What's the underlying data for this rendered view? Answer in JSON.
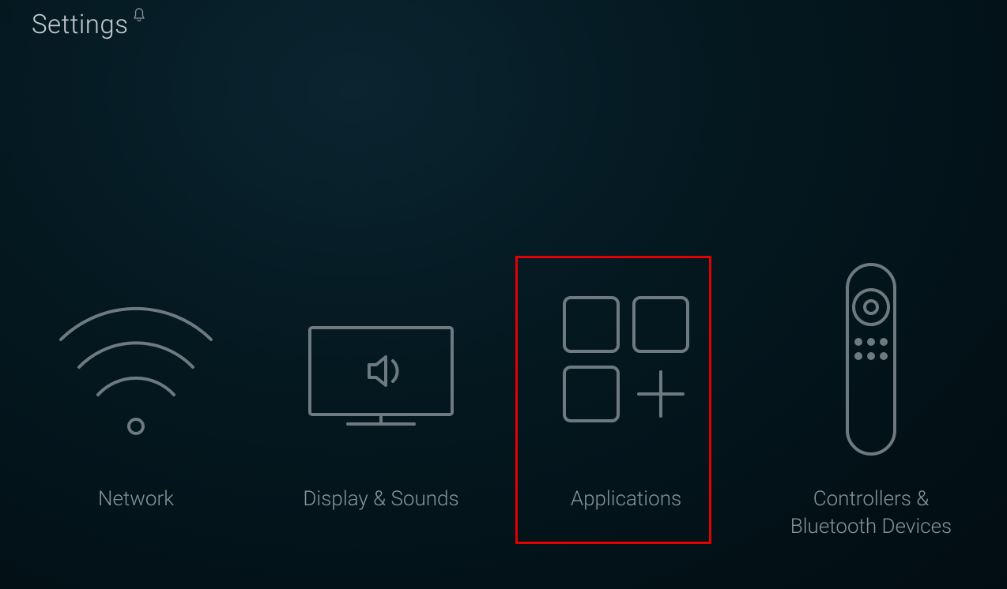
{
  "header": {
    "title": "Settings",
    "notification_icon": "bell-icon"
  },
  "tiles": [
    {
      "id": "network",
      "label": "Network",
      "icon": "wifi-icon"
    },
    {
      "id": "display-sounds",
      "label": "Display & Sounds",
      "icon": "tv-sound-icon"
    },
    {
      "id": "applications",
      "label": "Applications",
      "icon": "apps-icon",
      "highlighted": true
    },
    {
      "id": "controllers",
      "label": "Controllers & Bluetooth Devices",
      "icon": "remote-icon"
    }
  ],
  "colors": {
    "stroke": "#6e7a80",
    "highlight": "#e30000",
    "label": "#8a9499"
  }
}
